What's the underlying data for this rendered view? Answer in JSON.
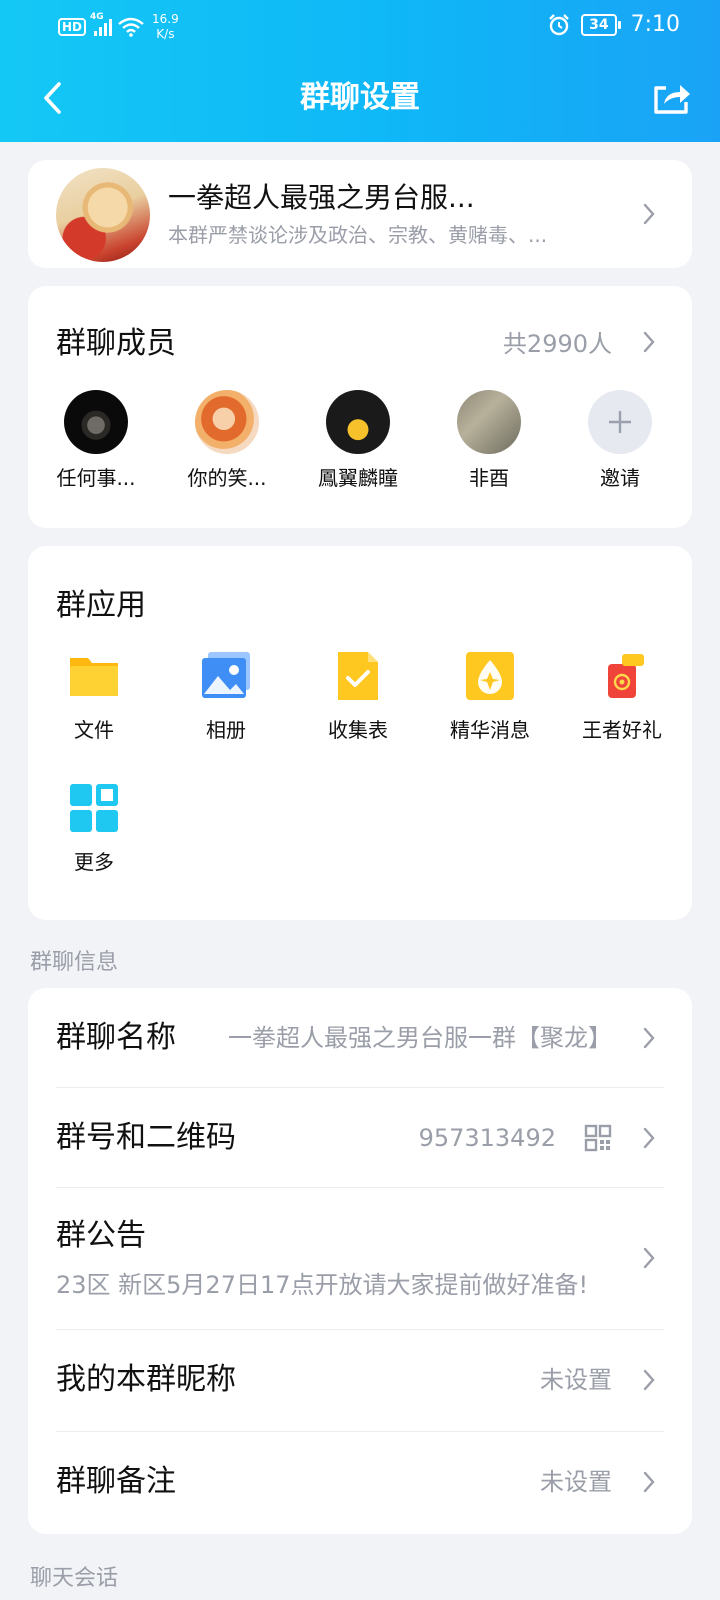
{
  "status_bar": {
    "hd": "HD",
    "network": "4G",
    "speed_value": "16.9",
    "speed_unit": "K/s",
    "battery": "34",
    "time": "7:10"
  },
  "header": {
    "title": "群聊设置"
  },
  "group": {
    "name": "一拳超人最强之男台服...",
    "description": "本群严禁谈论涉及政治、宗教、黄赌毒、..."
  },
  "members": {
    "title": "群聊成员",
    "count": "共2990人",
    "list": [
      {
        "name": "任何事..."
      },
      {
        "name": "你的笑..."
      },
      {
        "name": "鳳翼麟瞳"
      },
      {
        "name": "非酉"
      }
    ],
    "invite_label": "邀请"
  },
  "apps": {
    "title": "群应用",
    "items": [
      {
        "label": "文件",
        "icon": "folder-icon",
        "color": "#ffc41a"
      },
      {
        "label": "相册",
        "icon": "photo-album-icon",
        "color": "#3f8ef5"
      },
      {
        "label": "收集表",
        "icon": "form-check-icon",
        "color": "#ffc820"
      },
      {
        "label": "精华消息",
        "icon": "essence-drop-icon",
        "color": "#ffc820"
      },
      {
        "label": "王者好礼",
        "icon": "gift-icon",
        "color": "#f0443a"
      },
      {
        "label": "更多",
        "icon": "more-grid-icon",
        "color": "#1ec8f0"
      }
    ]
  },
  "info": {
    "section_label": "群聊信息",
    "rows": [
      {
        "label": "群聊名称",
        "value": "一拳超人最强之男台服一群【聚龙】"
      },
      {
        "label": "群号和二维码",
        "value": "957313492"
      },
      {
        "label": "群公告",
        "sub": "23区 新区5月27日17点开放请大家提前做好准备!"
      },
      {
        "label": "我的本群昵称",
        "value": "未设置"
      },
      {
        "label": "群聊备注",
        "value": "未设置"
      }
    ]
  },
  "chat": {
    "section_label": "聊天会话"
  }
}
